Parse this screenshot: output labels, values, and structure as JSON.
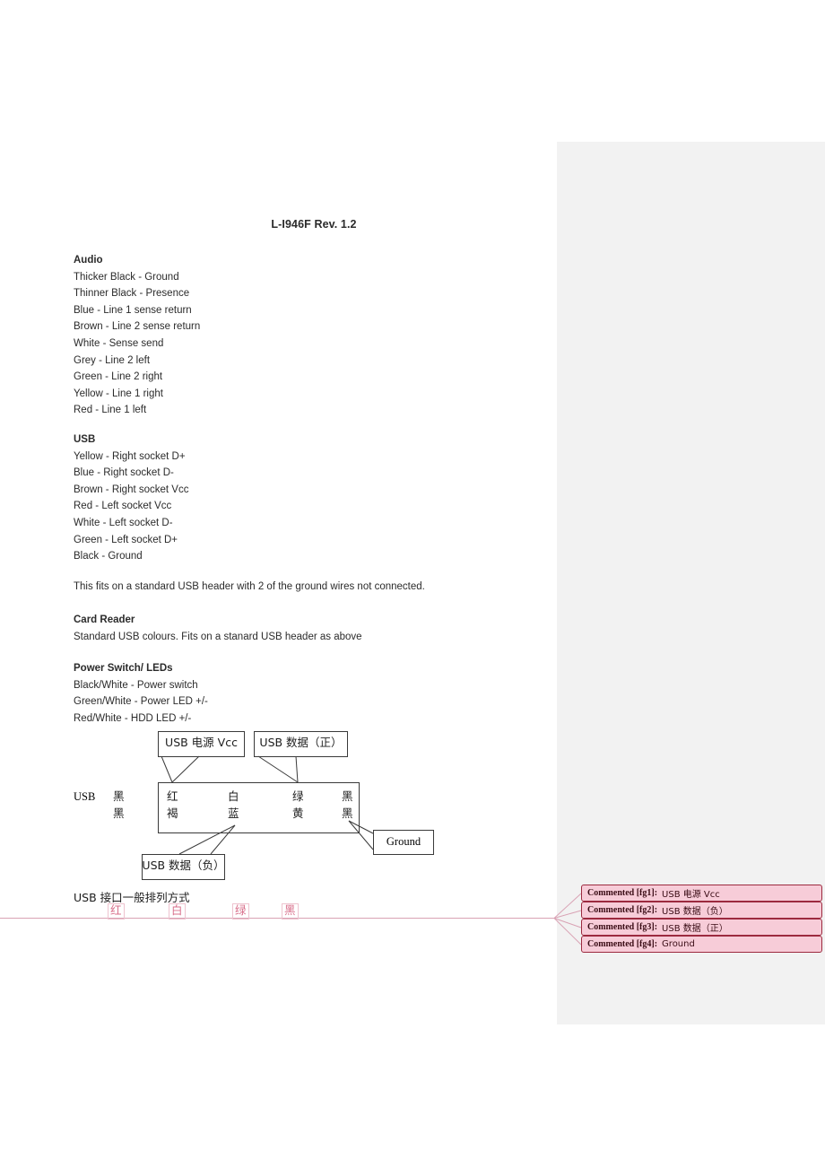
{
  "document": {
    "title": "L-I946F Rev. 1.2",
    "sections": [
      {
        "heading": "Audio",
        "lines": [
          "Thicker Black - Ground",
          "Thinner Black - Presence",
          "Blue - Line 1 sense return",
          "Brown - Line 2 sense return",
          "White - Sense send",
          "Grey - Line 2 left",
          "Green - Line 2 right",
          "Yellow - Line 1 right",
          "Red - Line 1 left"
        ]
      },
      {
        "heading": "USB",
        "lines": [
          "Yellow - Right socket D+",
          "Blue - Right socket D-",
          "Brown - Right socket Vcc",
          "Red - Left socket Vcc",
          "White - Left socket D-",
          "Green - Left socket D+",
          "Black - Ground"
        ]
      },
      {
        "heading": "",
        "lines": [
          "This fits on a standard USB header with 2 of the ground wires not connected."
        ]
      },
      {
        "heading": "Card Reader",
        "lines": [
          "Standard USB colours. Fits on a stanard USB header as above"
        ]
      },
      {
        "heading": "Power Switch/ LEDs",
        "lines": [
          "Black/White - Power switch",
          "Green/White - Power LED +/-",
          "Red/White - HDD LED +/-"
        ]
      }
    ]
  },
  "diagram": {
    "callout_vcc": "USB 电源 Vcc",
    "callout_data_pos": "USB 数据（正）",
    "callout_data_neg": "USB 数据（负）",
    "callout_ground": "Ground",
    "left_label": "USB",
    "left_pin_top": "黑",
    "left_pin_bottom": "黑",
    "row_top": [
      "红",
      "白",
      "绿",
      "黑"
    ],
    "row_bottom": [
      "褐",
      "蓝",
      "黄",
      "黑"
    ]
  },
  "anchor_row": {
    "label": "USB 接口一般排列方式",
    "chars": [
      "红",
      "白",
      "绿",
      "黑"
    ],
    "color": "#d86f8b"
  },
  "comments": {
    "accent_bg": "#f7ccd8",
    "accent_border": "#9c2a3f",
    "items": [
      {
        "tag": "Commented [fg1]:",
        "text": "USB 电源 Vcc"
      },
      {
        "tag": "Commented [fg2]:",
        "text": "USB 数据（负）"
      },
      {
        "tag": "Commented [fg3]:",
        "text": "USB 数据（正）"
      },
      {
        "tag": "Commented [fg4]:",
        "text": "Ground"
      }
    ]
  },
  "margin_panel": {
    "background": "#f2f2f2"
  }
}
